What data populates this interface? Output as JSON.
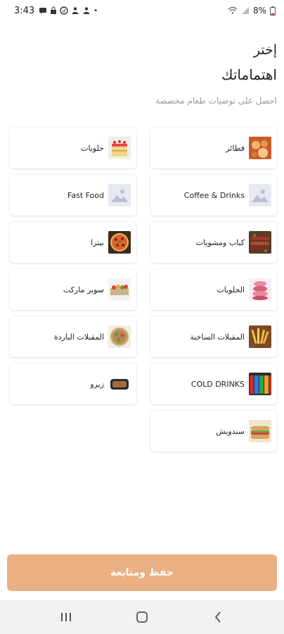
{
  "status_bar": {
    "time": "3:43",
    "battery": "8%"
  },
  "header": {
    "title_line1": "إختر",
    "title_line2": "اهتماماتك",
    "subtitle": "احصل على توصيات طعام مخصصة"
  },
  "categories": [
    {
      "label": "فطائر",
      "icon": "pastry-photo"
    },
    {
      "label": "حلويات",
      "icon": "cake-photo"
    },
    {
      "label": "Coffee & Drinks",
      "icon": "image-placeholder-icon"
    },
    {
      "label": "Fast Food",
      "icon": "image-placeholder-icon"
    },
    {
      "label": "كباب ومشويات",
      "icon": "grill-photo"
    },
    {
      "label": "بيتزا",
      "icon": "pizza-photo"
    },
    {
      "label": "الحلويات",
      "icon": "macarons-photo"
    },
    {
      "label": "سوبر ماركت",
      "icon": "market-photo"
    },
    {
      "label": "المقبلات الساخنة",
      "icon": "fries-photo"
    },
    {
      "label": "المقبلات الباردة",
      "icon": "salad-photo"
    },
    {
      "label": "COLD DRINKS",
      "icon": "cans-photo"
    },
    {
      "label": "زيرو",
      "icon": "tray-photo"
    },
    {
      "label": "سندويش",
      "icon": "sandwich-photo"
    }
  ],
  "actions": {
    "save_continue": "حفظ ومتابعة"
  },
  "colors": {
    "accent": "#e9b083",
    "card_bg": "#ffffff",
    "placeholder": "#e6e9f2"
  }
}
